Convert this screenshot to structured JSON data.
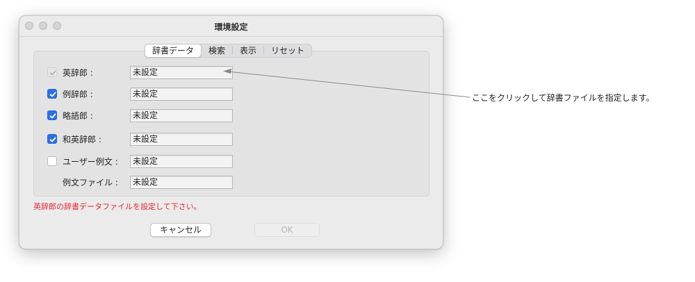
{
  "window": {
    "title": "環境設定"
  },
  "tabs": [
    {
      "label": "辞書データ",
      "active": true
    },
    {
      "label": "検索",
      "active": false
    },
    {
      "label": "表示",
      "active": false
    },
    {
      "label": "リセット",
      "active": false
    }
  ],
  "rows": [
    {
      "label": "英辞郎 :",
      "checkbox": "checked-disabled",
      "value": "未設定"
    },
    {
      "label": "例辞郎 :",
      "checkbox": "checked",
      "value": "未設定"
    },
    {
      "label": "略語郎 :",
      "checkbox": "checked",
      "value": "未設定"
    },
    {
      "label": "和英辞郎 :",
      "checkbox": "checked",
      "value": "未設定"
    },
    {
      "label": "ユーザー例文 :",
      "checkbox": "unchecked",
      "value": "未設定"
    },
    {
      "label": "例文ファイル :",
      "checkbox": "none",
      "value": "未設定"
    }
  ],
  "error_message": "英辞郎の辞書データファイルを設定して下さい。",
  "buttons": {
    "cancel": "キャンセル",
    "ok": "OK"
  },
  "annotation": "ここをクリックして辞書ファイルを指定します。",
  "colors": {
    "accent": "#2b6fe8",
    "error": "#e0262b"
  }
}
